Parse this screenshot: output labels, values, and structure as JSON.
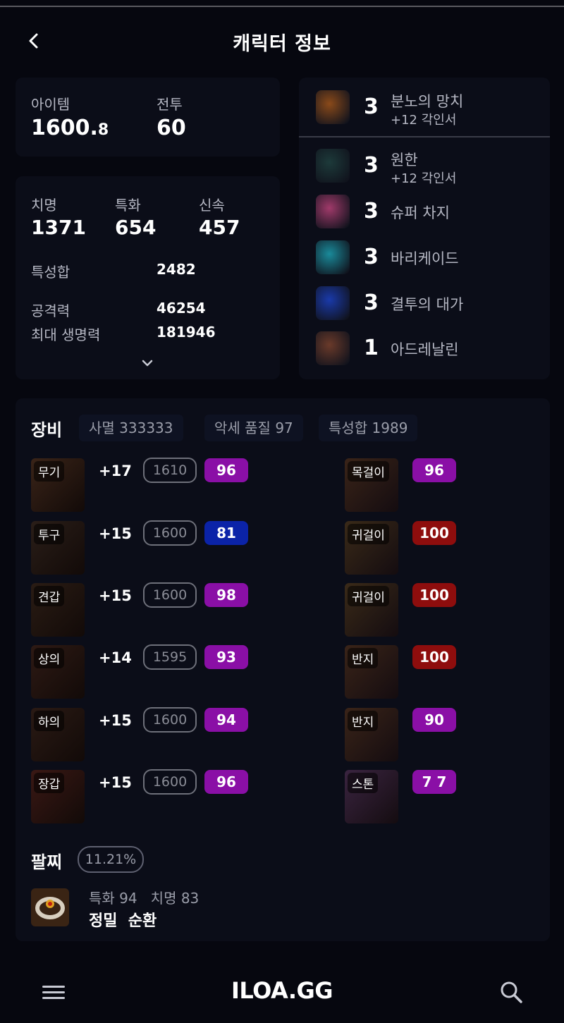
{
  "header": {
    "title": "캐릭터 정보"
  },
  "summary": {
    "item_label": "아이템",
    "item_value_main": "1600.",
    "item_value_decimal": "8",
    "combat_label": "전투",
    "combat_value": "60"
  },
  "stats": {
    "crit_label": "치명",
    "crit_value": "1371",
    "spec_label": "특화",
    "spec_value": "654",
    "swift_label": "신속",
    "swift_value": "457",
    "total_label": "특성합",
    "total_value": "2482",
    "attack_label": "공격력",
    "attack_value": "46254",
    "hp_label": "최대 생명력",
    "hp_value": "181946"
  },
  "engravings": [
    {
      "level": "3",
      "name": "분노의 망치",
      "sub": "+12 각인서",
      "icon": "hammer-icon",
      "color": "#8a4a1a"
    },
    {
      "level": "3",
      "name": "원한",
      "sub": "+12 각인서",
      "icon": "grudge-icon",
      "color": "#1d3a3a"
    },
    {
      "level": "3",
      "name": "슈퍼 차지",
      "sub": "",
      "icon": "super-charge-icon",
      "color": "#a03a6a"
    },
    {
      "level": "3",
      "name": "바리케이드",
      "sub": "",
      "icon": "barricade-icon",
      "color": "#1a8a9a"
    },
    {
      "level": "3",
      "name": "결투의 대가",
      "sub": "",
      "icon": "duel-icon",
      "color": "#1a3aaa"
    },
    {
      "level": "1",
      "name": "아드레날린",
      "sub": "",
      "icon": "adrenaline-icon",
      "color": "#6a3a2a"
    }
  ],
  "equipment": {
    "title": "장비",
    "pills": [
      "사멸 333333",
      "악세 품질 97",
      "특성합 1989"
    ],
    "armor": [
      {
        "tag": "무기",
        "refine": "+17",
        "ilvl": "1610",
        "quality": "96",
        "qclass": "q-purple",
        "icon": "weapon-icon",
        "color": "#3a2418"
      },
      {
        "tag": "투구",
        "refine": "+15",
        "ilvl": "1600",
        "quality": "81",
        "qclass": "q-blue",
        "icon": "helmet-icon",
        "color": "#2a1e18"
      },
      {
        "tag": "견갑",
        "refine": "+15",
        "ilvl": "1600",
        "quality": "98",
        "qclass": "q-purple",
        "icon": "shoulder-icon",
        "color": "#2a1c14"
      },
      {
        "tag": "상의",
        "refine": "+14",
        "ilvl": "1595",
        "quality": "93",
        "qclass": "q-purple",
        "icon": "chest-icon",
        "color": "#2e1a14"
      },
      {
        "tag": "하의",
        "refine": "+15",
        "ilvl": "1600",
        "quality": "94",
        "qclass": "q-purple",
        "icon": "pants-icon",
        "color": "#2a1a14"
      },
      {
        "tag": "장갑",
        "refine": "+15",
        "ilvl": "1600",
        "quality": "96",
        "qclass": "q-purple",
        "icon": "gloves-icon",
        "color": "#3a1814"
      }
    ],
    "accessories": [
      {
        "tag": "목걸이",
        "quality": "96",
        "qclass": "q-purple",
        "icon": "necklace-icon",
        "color": "#3a2418"
      },
      {
        "tag": "귀걸이",
        "quality": "100",
        "qclass": "q-red",
        "icon": "earring-icon",
        "color": "#3a2a18"
      },
      {
        "tag": "귀걸이",
        "quality": "100",
        "qclass": "q-red",
        "icon": "earring-icon",
        "color": "#3a2a18"
      },
      {
        "tag": "반지",
        "quality": "100",
        "qclass": "q-red",
        "icon": "ring-icon",
        "color": "#3a2418"
      },
      {
        "tag": "반지",
        "quality": "90",
        "qclass": "q-purple",
        "icon": "ring-icon",
        "color": "#3a2418"
      },
      {
        "tag": "스톤",
        "quality": "7 7",
        "qclass": "q-purple",
        "icon": "stone-icon",
        "color": "#3a2440"
      }
    ]
  },
  "bracelet": {
    "title": "팔찌",
    "percent": "11.21%",
    "stats_line": "특화 94   치명 83",
    "effect": "정밀  순환"
  },
  "bottom": {
    "logo": "ILOA.GG"
  }
}
